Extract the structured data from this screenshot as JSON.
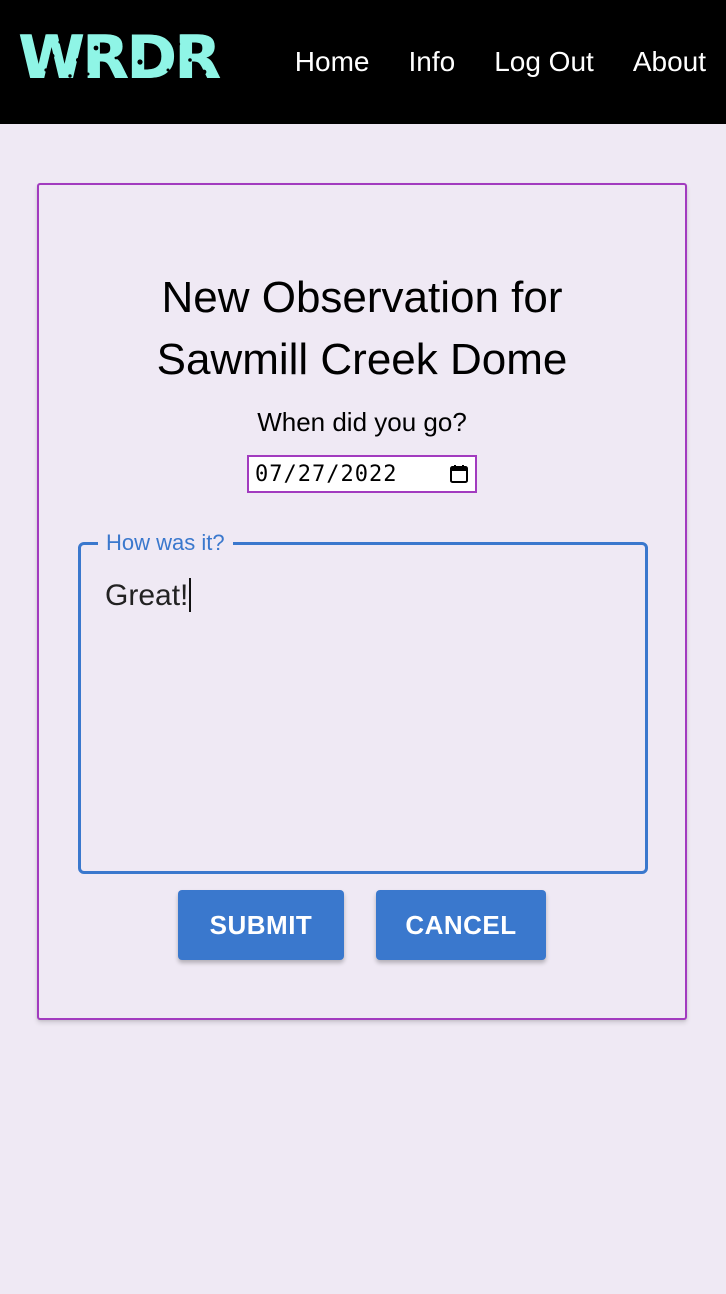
{
  "navbar": {
    "logo_text": "WRDR",
    "links": [
      {
        "label": "Home"
      },
      {
        "label": "Info"
      },
      {
        "label": "Log Out"
      },
      {
        "label": "About"
      }
    ]
  },
  "form": {
    "title_line1": "New Observation for",
    "title_line2": "Sawmill Creek Dome",
    "date_label": "When did you go?",
    "date_value": "07/27/2022",
    "notes_legend": "How was it?",
    "notes_value": "Great!",
    "submit_label": "SUBMIT",
    "cancel_label": "CANCEL"
  },
  "colors": {
    "nav_background": "#000000",
    "logo": "#8ff5e6",
    "card_border": "#a23bbf",
    "accent": "#3a78cd",
    "page_background": "#efe9f4"
  },
  "icons": [
    "calendar-icon"
  ]
}
